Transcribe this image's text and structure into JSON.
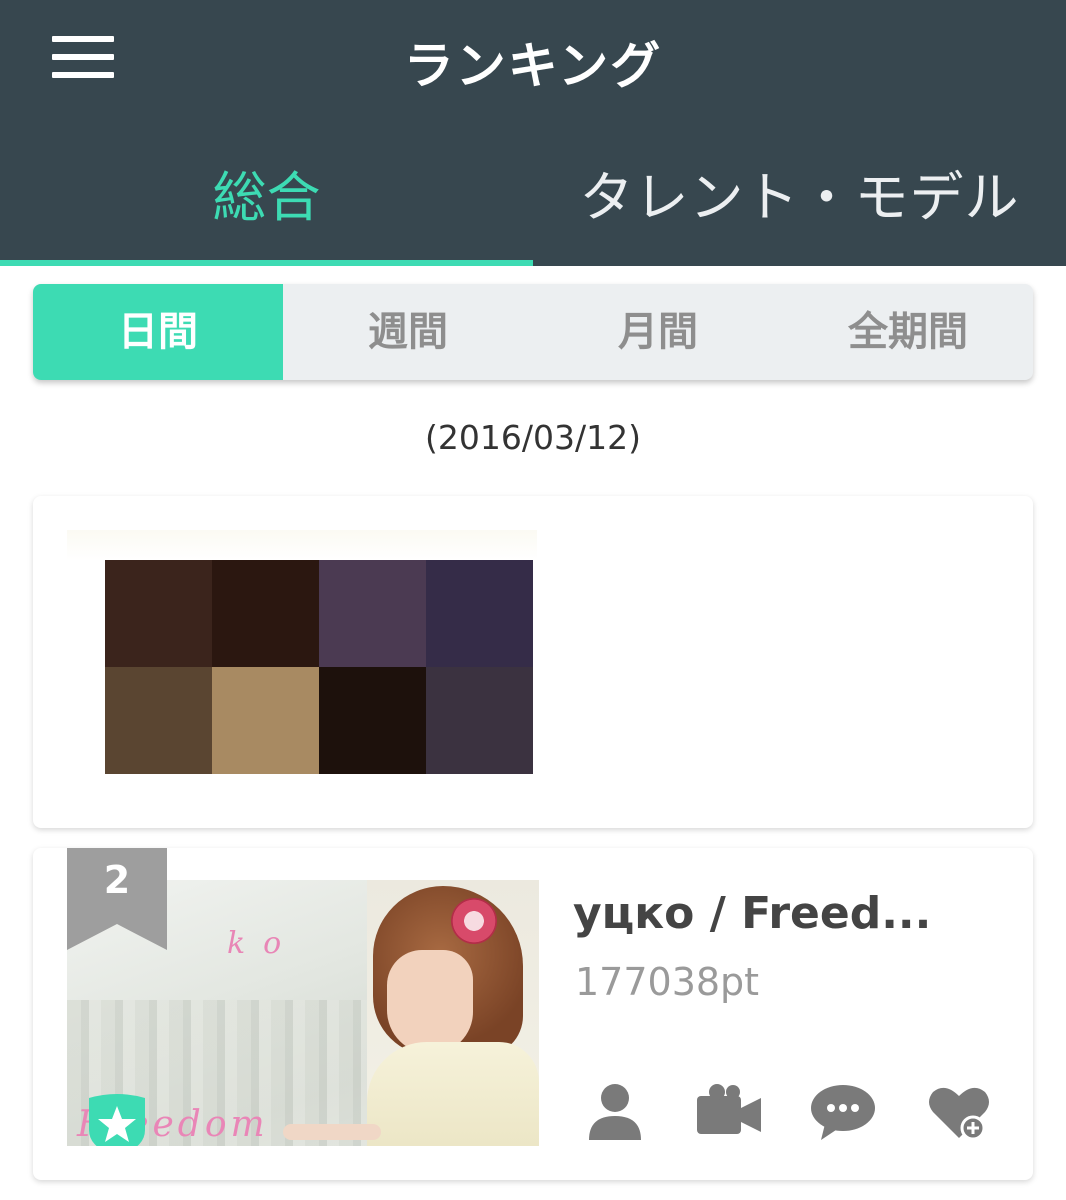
{
  "header": {
    "title": "ランキング",
    "background": "#37474f",
    "accent": "#3ddbb3"
  },
  "tabs": [
    {
      "label": "総合",
      "active": true
    },
    {
      "label": "タレント・モデル",
      "active": false
    }
  ],
  "periods": [
    {
      "label": "日間",
      "active": true
    },
    {
      "label": "週間",
      "active": false
    },
    {
      "label": "月間",
      "active": false
    },
    {
      "label": "全期間",
      "active": false
    }
  ],
  "date_label": "(2016/03/12)",
  "mosaic_colors": [
    "#3b241c",
    "#2b1710",
    "#4b3a52",
    "#352c48",
    "#5a4531",
    "#a88a62",
    "#1d110c",
    "#3b3240"
  ],
  "ranking": [
    {
      "rank": "2",
      "name": "уцко / Freed...",
      "points": "177038pt",
      "thumbnail_text": {
        "top": "ko",
        "bottom": "Freedom"
      },
      "badge_icon": "star-icon",
      "actions": [
        "profile-icon",
        "video-icon",
        "comment-icon",
        "favorite-add-icon"
      ]
    }
  ]
}
